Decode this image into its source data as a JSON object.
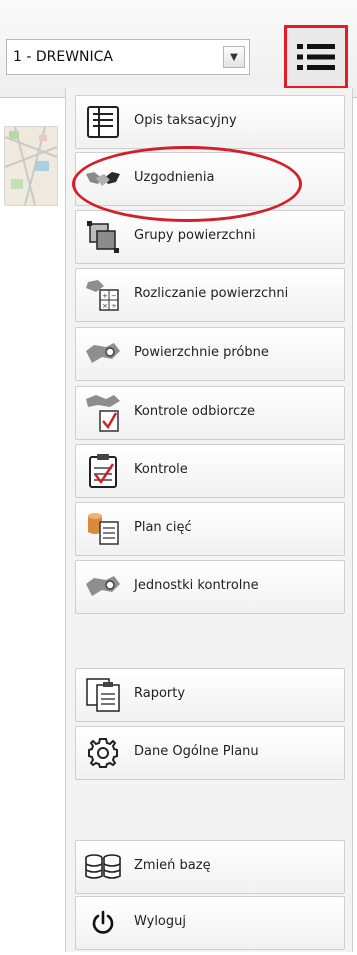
{
  "toolbar": {
    "select_value": "1 - DREWNICA"
  },
  "menu": {
    "items": [
      {
        "label": "Opis taksacyjny",
        "icon": "description-icon"
      },
      {
        "label": "Uzgodnienia",
        "icon": "handshake-icon"
      },
      {
        "label": "Grupy powierzchni",
        "icon": "area-groups-icon"
      },
      {
        "label": "Rozliczanie powierzchni",
        "icon": "area-calculation-icon"
      },
      {
        "label": "Powierzchnie próbne",
        "icon": "sample-plots-icon"
      },
      {
        "label": "Kontrole odbiorcze",
        "icon": "acceptance-checks-icon"
      },
      {
        "label": "Kontrole",
        "icon": "checks-icon"
      },
      {
        "label": "Plan cięć",
        "icon": "cutting-plan-icon"
      },
      {
        "label": "Jednostki kontrolne",
        "icon": "control-units-icon"
      },
      {
        "label": "Raporty",
        "icon": "reports-icon"
      },
      {
        "label": "Dane Ogólne Planu",
        "icon": "gear-icon"
      },
      {
        "label": "Zmień bazę",
        "icon": "database-icon"
      },
      {
        "label": "Wyloguj",
        "icon": "power-icon"
      }
    ]
  },
  "colors": {
    "highlight": "#e31c25",
    "panel_bg": "#f3f3f3"
  }
}
